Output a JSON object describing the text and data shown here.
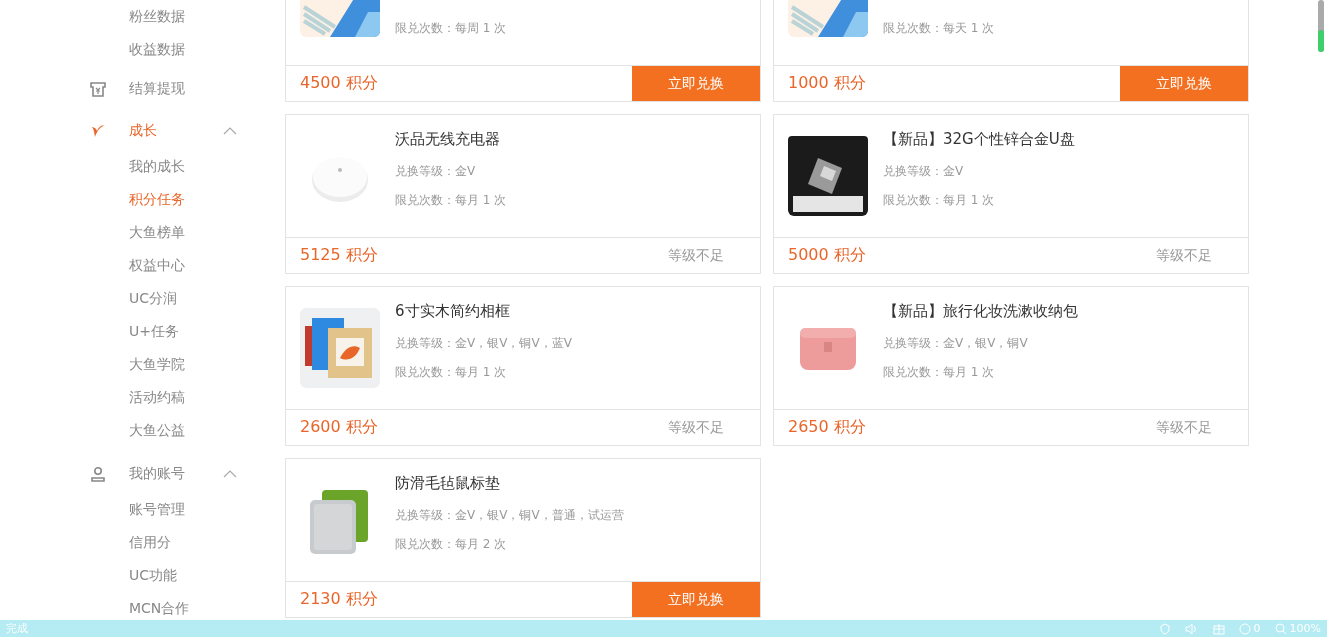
{
  "sidebar": {
    "items": [
      {
        "kind": "sub",
        "label": "粉丝数据",
        "selected": false
      },
      {
        "kind": "sub",
        "label": "收益数据",
        "selected": false
      },
      {
        "kind": "wallet",
        "label": "结算提现",
        "selected": false
      },
      {
        "kind": "growth",
        "label": "成长",
        "selected": true,
        "expanded": true,
        "children": [
          {
            "label": "我的成长",
            "selected": false
          },
          {
            "label": "积分任务",
            "selected": true
          },
          {
            "label": "大鱼榜单",
            "selected": false
          },
          {
            "label": "权益中心",
            "selected": false
          },
          {
            "label": "UC分润",
            "selected": false
          },
          {
            "label": "U+任务",
            "selected": false
          },
          {
            "label": "大鱼学院",
            "selected": false
          },
          {
            "label": "活动约稿",
            "selected": false
          },
          {
            "label": "大鱼公益",
            "selected": false
          }
        ]
      },
      {
        "kind": "account",
        "label": "我的账号",
        "selected": false,
        "expanded": true,
        "children": [
          {
            "label": "账号管理",
            "selected": false
          },
          {
            "label": "信用分",
            "selected": false
          },
          {
            "label": "UC功能",
            "selected": false
          },
          {
            "label": "MCN合作",
            "selected": false
          }
        ]
      }
    ]
  },
  "products": [
    {
      "kind": "document",
      "limit": "限兑次数：每周 1 次",
      "price": "4500 积分",
      "action": {
        "kind": "button",
        "label": "立即兑换"
      }
    },
    {
      "kind": "document",
      "limit": "限兑次数：每天 1 次",
      "price": "1000 积分",
      "action": {
        "kind": "button",
        "label": "立即兑换"
      }
    },
    {
      "kind": "charger",
      "name": "沃品无线充电器",
      "levels": "兑换等级：金V",
      "limit": "限兑次数：每月 1 次",
      "price": "5125 积分",
      "action": {
        "kind": "note",
        "label": "等级不足"
      }
    },
    {
      "kind": "usb",
      "name": "【新品】32G个性锌合金U盘",
      "levels": "兑换等级：金V",
      "limit": "限兑次数：每月 1 次",
      "price": "5000 积分",
      "action": {
        "kind": "note",
        "label": "等级不足"
      }
    },
    {
      "kind": "frames",
      "name": "6寸实木简约相框",
      "levels": "兑换等级：金V，银V，铜V，蓝V",
      "limit": "限兑次数：每月 1 次",
      "price": "2600 积分",
      "action": {
        "kind": "note",
        "label": "等级不足"
      }
    },
    {
      "kind": "pouch",
      "name": "【新品】旅行化妆洗漱收纳包",
      "levels": "兑换等级：金V，银V，铜V",
      "limit": "限兑次数：每月 1 次",
      "price": "2650 积分",
      "action": {
        "kind": "note",
        "label": "等级不足"
      }
    },
    {
      "kind": "mousepad",
      "name": "防滑毛毡鼠标垫",
      "levels": "兑换等级：金V，银V，铜V，普通，试运营",
      "limit": "限兑次数：每月 2 次",
      "price": "2130 积分",
      "action": {
        "kind": "button",
        "label": "立即兑换"
      }
    }
  ],
  "status_bar": {
    "status": "完成",
    "counter": "0",
    "zoom": "100%"
  }
}
